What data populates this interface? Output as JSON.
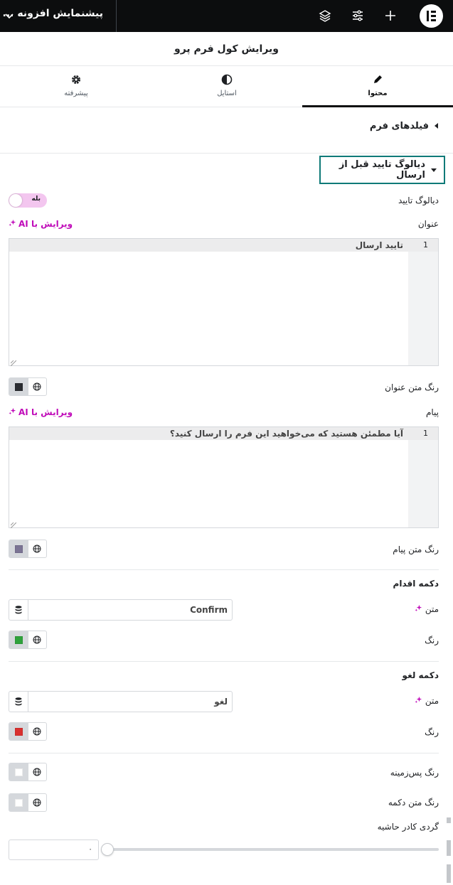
{
  "topbar": {
    "document_title": "پیشنمایش افزونه ...",
    "icons": [
      "elementor-logo-icon",
      "plus-icon",
      "sliders-icon",
      "layers-icon",
      "chevron-down-icon"
    ]
  },
  "panel": {
    "title": "ویرایش کول فرم پرو"
  },
  "tabs": [
    {
      "label": "محتوا",
      "icon": "pencil-icon",
      "active": true
    },
    {
      "label": "استایل",
      "icon": "half-circle-icon",
      "active": false
    },
    {
      "label": "پیشرفته",
      "icon": "gear-icon",
      "active": false
    }
  ],
  "sections": {
    "form_fields": "فیلدهای فرم",
    "confirm_dialog": "دیالوگ تایید قبل از ارسال"
  },
  "confirm_toggle": {
    "label": "دیالوگ تایید",
    "value": "بله",
    "on": true
  },
  "ai_edit_label": "ویرایش با AI",
  "title_field": {
    "label": "عنوان",
    "line_number": "1",
    "value": "تایید ارسال"
  },
  "title_color": {
    "label": "رنگ متن عنوان",
    "color": "#2a2c31"
  },
  "message_field": {
    "label": "پیام",
    "line_number": "1",
    "value": "آیا مطمئن هستید که می‌خواهید این فرم را ارسال کنید؟"
  },
  "message_color": {
    "label": "رنگ متن پیام",
    "color": "#7b7494"
  },
  "action_button": {
    "heading": "دکمه اقدام",
    "text_label": "متن",
    "text_value": "Confirm",
    "color_label": "رنگ",
    "color": "#2fa23c"
  },
  "cancel_button": {
    "heading": "دکمه لغو",
    "text_label": "متن",
    "text_value": "لغو",
    "color_label": "رنگ",
    "color": "#d9302f"
  },
  "background_color": {
    "label": "رنگ پس‌زمینه",
    "color": "#ffffff"
  },
  "button_text_color": {
    "label": "رنگ متن دکمه",
    "color": "#ffffff"
  },
  "border_radius": {
    "label": "گردی کادر حاشیه",
    "value": "۰"
  },
  "colors": {
    "accent": "#c00bb9",
    "focus_border": "#0f7a78",
    "topbar": "#0c0d0e"
  }
}
